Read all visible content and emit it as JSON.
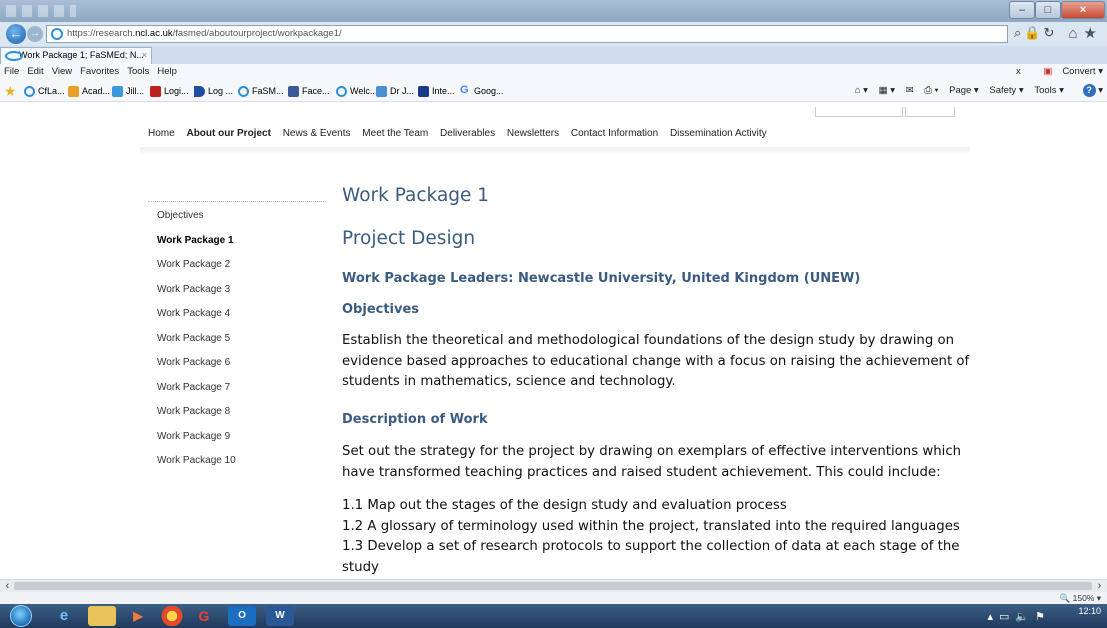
{
  "browser": {
    "url_prefix": "https://research.",
    "url_domain": "ncl.ac.uk",
    "url_path": "/fasmed/aboutourproject/workpackage1/",
    "tab_title": "Work Package 1; FaSMEd; N...",
    "menu": [
      "File",
      "Edit",
      "View",
      "Favorites",
      "Tools",
      "Help"
    ],
    "menu_right": {
      "close": "x",
      "convert": "Convert"
    },
    "favorites": [
      "CfLa...",
      "Acad...",
      "Jill...",
      "Logi...",
      "Log ...",
      "FaSM...",
      "Face...",
      "Welc...",
      "Dr J...",
      "Inte...",
      "Goog..."
    ],
    "commands": {
      "page": "Page ▾",
      "safety": "Safety ▾",
      "tools": "Tools ▾"
    },
    "zoom": "150%"
  },
  "site": {
    "nav": [
      "Home",
      "About our Project",
      "News & Events",
      "Meet the Team",
      "Deliverables",
      "Newsletters",
      "Contact Information",
      "Dissemination Activity"
    ],
    "sidebar": [
      "Objectives",
      "Work Package 1",
      "Work Package 2",
      "Work Package 3",
      "Work Package 4",
      "Work Package 5",
      "Work Package 6",
      "Work Package 7",
      "Work Package 8",
      "Work Package 9",
      "Work Package 10"
    ]
  },
  "content": {
    "title": "Work Package 1",
    "subtitle": "Project Design",
    "leaders": "Work Package Leaders: Newcastle University, United Kingdom (UNEW)",
    "objectives_heading": "Objectives",
    "objectives_lines": [
      "Establish the theoretical and methodological foundations of the design study by drawing on",
      "evidence based approaches to educational change with a focus on raising the achievement of",
      "students in mathematics, science and technology."
    ],
    "description_heading": "Description of Work",
    "description_lines": [
      "Set out the strategy for the project by drawing on exemplars of effective interventions which",
      "have transformed teaching practices and raised student achievement. This could include:"
    ],
    "list_lines": [
      "1.1 Map out the stages of the design study and evaluation process",
      "1.2 A glossary of terminology used within the project, translated into the required languages",
      "1.3 Develop a set of research protocols to support the collection of data at each stage of the",
      "study"
    ]
  },
  "taskbar": {
    "time": "12:10"
  }
}
